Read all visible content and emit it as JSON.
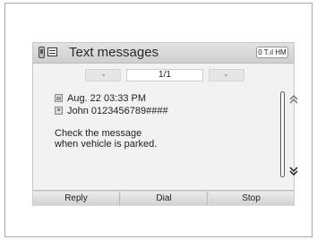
{
  "header": {
    "title": "Text messages",
    "status_text": "0 T.ıl HM",
    "phone_icon": "phone-icon",
    "message_icon": "message-icon"
  },
  "navigation": {
    "prev_label": "◂",
    "page_indicator": "1/1",
    "next_label": "▸"
  },
  "message": {
    "date_time": "Aug. 22 03:33 PM",
    "sender": "John 0123456789####",
    "body_lines": [
      "Check the message",
      "when vehicle is parked."
    ],
    "date_icon": "calendar-icon",
    "sender_icon": "contact-icon"
  },
  "scroll": {
    "up_icon": "double-chevron-up-icon",
    "down_icon": "double-chevron-down-icon"
  },
  "softkeys": {
    "reply_label": "Reply",
    "dial_label": "Dial",
    "stop_label": "Stop"
  }
}
